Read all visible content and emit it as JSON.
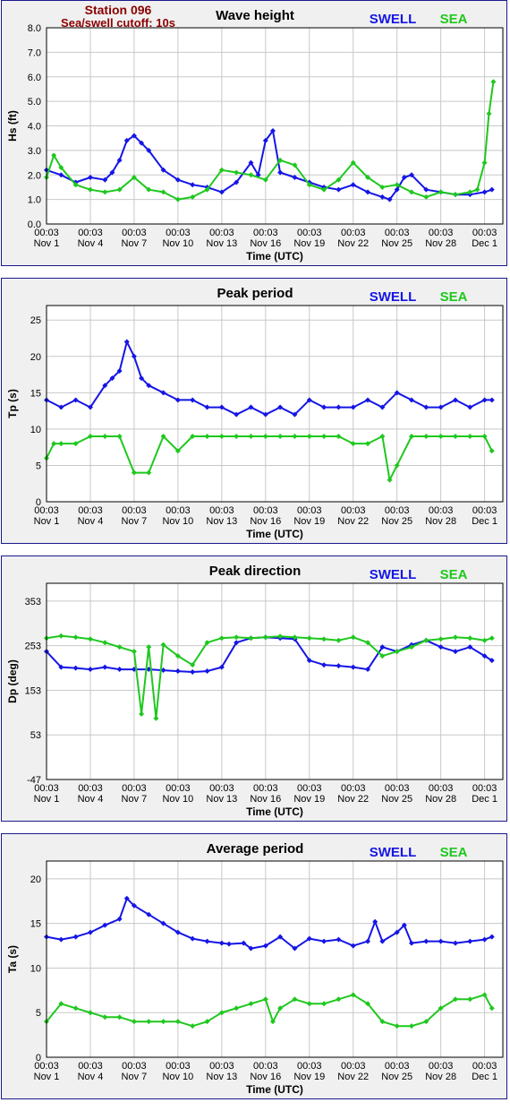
{
  "header": {
    "station": "Station 096",
    "cutoff": "Sea/swell cutoff: 10s"
  },
  "colors": {
    "swell": "#1515e6",
    "sea": "#1ec81e",
    "header": "#8b0000"
  },
  "x_ticks": {
    "time_labels": [
      "00:03",
      "00:03",
      "00:03",
      "00:03",
      "00:03",
      "00:03",
      "00:03",
      "00:03",
      "00:03",
      "00:03",
      "00:03"
    ],
    "date_labels": [
      "Nov 1",
      "Nov 4",
      "Nov 7",
      "Nov 10",
      "Nov 13",
      "Nov 16",
      "Nov 19",
      "Nov 22",
      "Nov 25",
      "Nov 28",
      "Dec 1"
    ],
    "days": [
      1,
      4,
      7,
      10,
      13,
      16,
      19,
      22,
      25,
      28,
      31
    ]
  },
  "chart_data": [
    {
      "type": "line",
      "title": "Wave height",
      "xlabel": "Time (UTC)",
      "ylabel": "Hs (ft)",
      "ylim": [
        0,
        8
      ],
      "yticks": [
        "0.0",
        "1.0",
        "2.0",
        "3.0",
        "4.0",
        "5.0",
        "6.0",
        "7.0",
        "8.0"
      ],
      "ytick_values": [
        0,
        1,
        2,
        3,
        4,
        5,
        6,
        7,
        8
      ],
      "x_unit": "day of Nov (UTC), continuous",
      "legend": [
        "SWELL",
        "SEA"
      ],
      "grid": true,
      "series": [
        {
          "name": "SWELL",
          "x": [
            1,
            2,
            3,
            4,
            5,
            5.5,
            6,
            6.5,
            7,
            7.5,
            8,
            9,
            10,
            11,
            12,
            13,
            14,
            15,
            15.5,
            16,
            16.5,
            17,
            18,
            19,
            20,
            21,
            22,
            23,
            24,
            24.5,
            25,
            25.5,
            26,
            27,
            28,
            29,
            30,
            31,
            31.5
          ],
          "values": [
            2.2,
            2.0,
            1.7,
            1.9,
            1.8,
            2.1,
            2.6,
            3.4,
            3.6,
            3.3,
            3.0,
            2.2,
            1.8,
            1.6,
            1.5,
            1.3,
            1.7,
            2.5,
            2.0,
            3.4,
            3.8,
            2.1,
            1.9,
            1.7,
            1.5,
            1.4,
            1.6,
            1.3,
            1.1,
            1.0,
            1.4,
            1.9,
            2.0,
            1.4,
            1.3,
            1.2,
            1.2,
            1.3,
            1.4
          ]
        },
        {
          "name": "SEA",
          "x": [
            1,
            1.5,
            2,
            3,
            4,
            5,
            6,
            7,
            8,
            9,
            10,
            11,
            12,
            13,
            14,
            15,
            16,
            17,
            18,
            19,
            20,
            21,
            22,
            23,
            24,
            25,
            26,
            27,
            28,
            29,
            30,
            30.5,
            31,
            31.3,
            31.6
          ],
          "values": [
            1.9,
            2.8,
            2.3,
            1.6,
            1.4,
            1.3,
            1.4,
            1.9,
            1.4,
            1.3,
            1.0,
            1.1,
            1.4,
            2.2,
            2.1,
            2.0,
            1.8,
            2.6,
            2.4,
            1.6,
            1.4,
            1.8,
            2.5,
            1.9,
            1.5,
            1.6,
            1.3,
            1.1,
            1.3,
            1.2,
            1.3,
            1.4,
            2.5,
            4.5,
            5.8
          ]
        }
      ]
    },
    {
      "type": "line",
      "title": "Peak period",
      "xlabel": "Time (UTC)",
      "ylabel": "Tp (s)",
      "ylim": [
        0,
        27
      ],
      "yticks": [
        "0",
        "5",
        "10",
        "15",
        "20",
        "25"
      ],
      "ytick_values": [
        0,
        5,
        10,
        15,
        20,
        25
      ],
      "x_unit": "day of Nov (UTC), continuous",
      "legend": [
        "SWELL",
        "SEA"
      ],
      "grid": true,
      "series": [
        {
          "name": "SWELL",
          "x": [
            1,
            2,
            3,
            4,
            5,
            5.5,
            6,
            6.5,
            7,
            7.5,
            8,
            9,
            10,
            11,
            12,
            13,
            14,
            15,
            16,
            17,
            18,
            19,
            20,
            21,
            22,
            23,
            24,
            25,
            26,
            27,
            28,
            29,
            30,
            31,
            31.5
          ],
          "values": [
            14,
            13,
            14,
            13,
            16,
            17,
            18,
            22,
            20,
            17,
            16,
            15,
            14,
            14,
            13,
            13,
            12,
            13,
            12,
            13,
            12,
            14,
            13,
            13,
            13,
            14,
            13,
            15,
            14,
            13,
            13,
            14,
            13,
            14,
            14
          ]
        },
        {
          "name": "SEA",
          "x": [
            1,
            1.5,
            2,
            3,
            4,
            5,
            6,
            7,
            8,
            9,
            10,
            11,
            12,
            13,
            14,
            15,
            16,
            17,
            18,
            19,
            20,
            21,
            22,
            23,
            24,
            24.5,
            25,
            26,
            27,
            28,
            29,
            30,
            31,
            31.5
          ],
          "values": [
            6,
            8,
            8,
            8,
            9,
            9,
            9,
            4,
            4,
            9,
            7,
            9,
            9,
            9,
            9,
            9,
            9,
            9,
            9,
            9,
            9,
            9,
            8,
            8,
            9,
            3,
            5,
            9,
            9,
            9,
            9,
            9,
            9,
            7
          ]
        }
      ]
    },
    {
      "type": "line",
      "title": "Peak direction",
      "xlabel": "Time (UTC)",
      "ylabel": "Dp (deg)",
      "ylim": [
        -47,
        393
      ],
      "yticks": [
        "-47",
        "53",
        "153",
        "253",
        "353"
      ],
      "ytick_values": [
        -47,
        53,
        153,
        253,
        353
      ],
      "x_unit": "day of Nov (UTC), continuous",
      "legend": [
        "SWELL",
        "SEA"
      ],
      "grid": true,
      "series": [
        {
          "name": "SWELL",
          "x": [
            1,
            2,
            3,
            4,
            5,
            6,
            7,
            8,
            9,
            10,
            11,
            12,
            13,
            14,
            15,
            16,
            17,
            18,
            19,
            20,
            21,
            22,
            23,
            24,
            25,
            26,
            27,
            28,
            29,
            30,
            31,
            31.5
          ],
          "values": [
            240,
            205,
            203,
            200,
            205,
            200,
            200,
            200,
            198,
            196,
            194,
            196,
            205,
            260,
            270,
            272,
            270,
            268,
            220,
            210,
            208,
            205,
            200,
            250,
            240,
            255,
            265,
            250,
            240,
            250,
            230,
            220
          ]
        },
        {
          "name": "SEA",
          "x": [
            1,
            2,
            3,
            4,
            5,
            6,
            7,
            7.5,
            8,
            8.5,
            9,
            10,
            11,
            12,
            13,
            14,
            15,
            16,
            17,
            18,
            19,
            20,
            21,
            22,
            23,
            24,
            25,
            26,
            27,
            28,
            29,
            30,
            31,
            31.5
          ],
          "values": [
            270,
            275,
            272,
            268,
            260,
            250,
            240,
            100,
            250,
            90,
            255,
            230,
            210,
            260,
            270,
            272,
            270,
            272,
            274,
            272,
            270,
            268,
            265,
            272,
            260,
            230,
            240,
            250,
            265,
            268,
            272,
            270,
            265,
            270
          ]
        }
      ]
    },
    {
      "type": "line",
      "title": "Average period",
      "xlabel": "Time (UTC)",
      "ylabel": "Ta (s)",
      "ylim": [
        0,
        22
      ],
      "yticks": [
        "0",
        "5",
        "10",
        "15",
        "20"
      ],
      "ytick_values": [
        0,
        5,
        10,
        15,
        20
      ],
      "x_unit": "day of Nov (UTC), continuous",
      "legend": [
        "SWELL",
        "SEA"
      ],
      "grid": true,
      "series": [
        {
          "name": "SWELL",
          "x": [
            1,
            2,
            3,
            4,
            5,
            6,
            6.5,
            7,
            8,
            9,
            10,
            11,
            12,
            13,
            13.5,
            14.5,
            15,
            16,
            17,
            18,
            19,
            20,
            21,
            22,
            23,
            23.5,
            24,
            25,
            25.5,
            26,
            27,
            28,
            29,
            30,
            31,
            31.5
          ],
          "values": [
            13.5,
            13.2,
            13.5,
            14.0,
            14.8,
            15.5,
            17.8,
            17.0,
            16.0,
            15.0,
            14.0,
            13.3,
            13.0,
            12.8,
            12.7,
            12.8,
            12.2,
            12.5,
            13.5,
            12.2,
            13.3,
            13.0,
            13.2,
            12.5,
            13.0,
            15.2,
            13.0,
            14.0,
            14.8,
            12.8,
            13.0,
            13.0,
            12.8,
            13.0,
            13.2,
            13.5
          ]
        },
        {
          "name": "SEA",
          "x": [
            1,
            2,
            3,
            4,
            5,
            6,
            7,
            8,
            9,
            10,
            11,
            12,
            13,
            14,
            15,
            16,
            16.5,
            17,
            18,
            19,
            20,
            21,
            22,
            23,
            24,
            25,
            26,
            27,
            28,
            29,
            30,
            31,
            31.5
          ],
          "values": [
            4.0,
            6.0,
            5.5,
            5.0,
            4.5,
            4.5,
            4.0,
            4.0,
            4.0,
            4.0,
            3.5,
            4.0,
            5.0,
            5.5,
            6.0,
            6.5,
            4.0,
            5.5,
            6.5,
            6.0,
            6.0,
            6.5,
            7.0,
            6.0,
            4.0,
            3.5,
            3.5,
            4.0,
            5.5,
            6.5,
            6.5,
            7.0,
            5.5
          ]
        }
      ]
    }
  ]
}
